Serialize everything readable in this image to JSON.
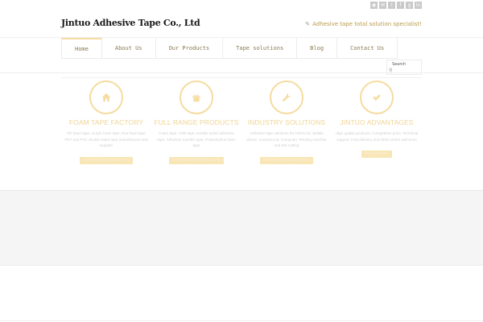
{
  "header": {
    "logo_text": "Jintuo Adhesive Tape Co., Ltd",
    "slogan": "Adhesive tape total solution specialist!",
    "social_icons": [
      "rss-icon",
      "mail-icon",
      "twitter-icon",
      "facebook-icon",
      "googleplus-icon",
      "linkedin-icon"
    ]
  },
  "nav": {
    "items": [
      {
        "label": "Home",
        "active": true
      },
      {
        "label": "About Us",
        "active": false
      },
      {
        "label": "Our Products",
        "active": false
      },
      {
        "label": "Tape solutions",
        "active": false
      },
      {
        "label": "Blog",
        "active": false
      },
      {
        "label": "Contact Us",
        "active": false
      }
    ]
  },
  "search": {
    "label": "Search",
    "placeholder": ""
  },
  "features": [
    {
      "icon": "home-icon",
      "title": "FOAM TAPE FACTORY",
      "desc": "PE foam tape, Acrylic foam tape, Eva foam tape PET and PVC double sided tape manufacturer and supplier",
      "button": "LEARN MORE ABOUT US"
    },
    {
      "icon": "gift-icon",
      "title": "FULL RANGE PRODUCTS",
      "desc": "Foam tape, VHB tape, Double sided adhesive tape, Adhesive transfer tape, Polyethylene foam tape",
      "button": "LEARN MORE PRODUCTS"
    },
    {
      "icon": "wrench-icon",
      "title": "INDUSTRY SOLUTIONS",
      "desc": "Adhesive tape solutions for LED/LCD, Mobile phone, Camera,Car, Computer, Printing machine and Die cutting",
      "button": "READ MORE SOLUTIONS"
    },
    {
      "icon": "check-icon",
      "title": "JINTUO ADVANTAGES",
      "desc": "High quality products, Competitive price, Technical support, Fast delivery and OEM orders welcome!",
      "button": "READ MORE"
    }
  ],
  "colors": {
    "accent": "#f5dca0",
    "title": "#f0d494",
    "nav_text": "#8a7a52",
    "grey_band": "#f5f5f5"
  }
}
